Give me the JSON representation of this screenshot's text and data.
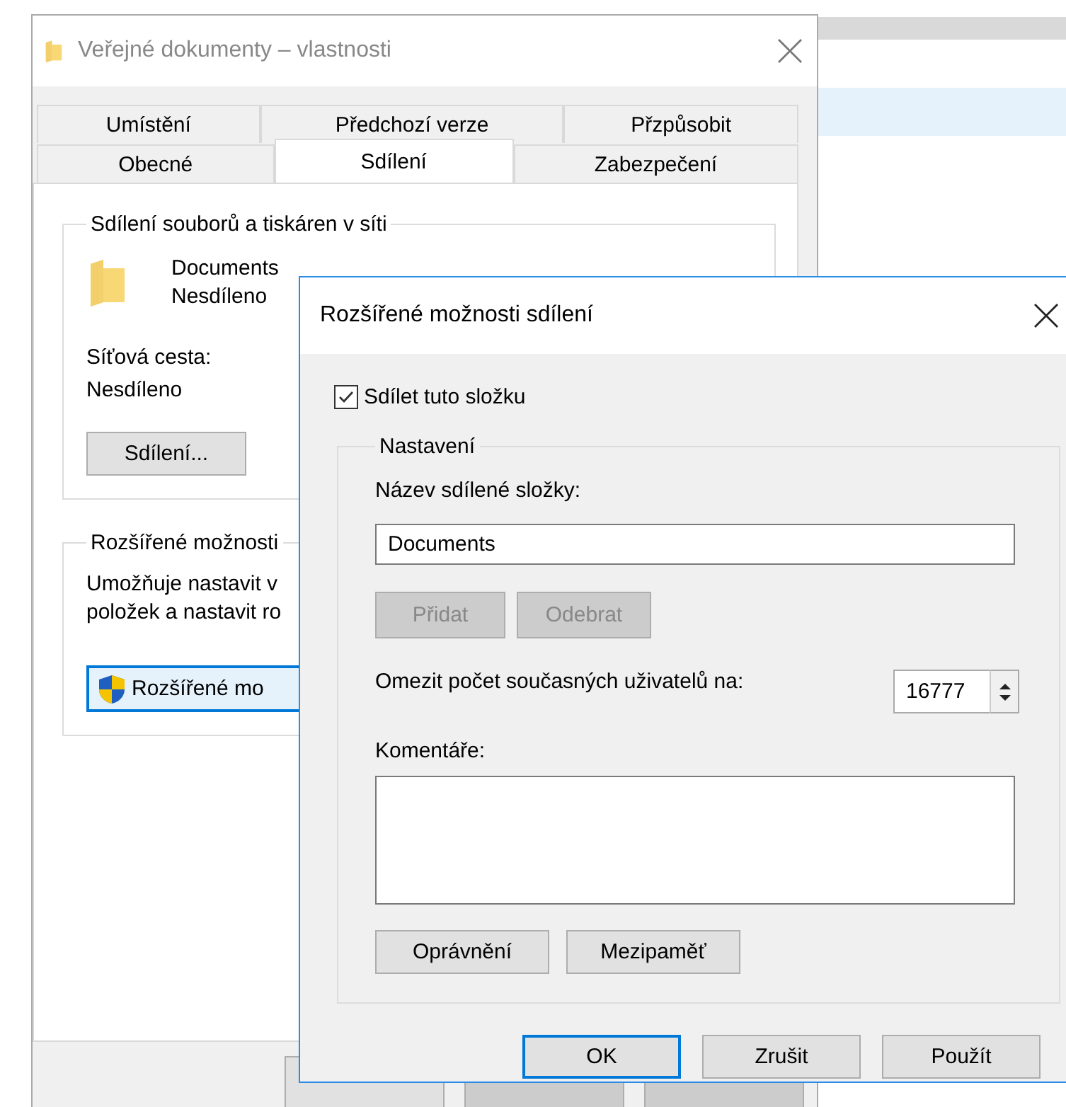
{
  "properties_window": {
    "title": "Veřejné dokumenty – vlastnosti",
    "tab_rows": [
      [
        {
          "label": "Umístění",
          "selected": false
        },
        {
          "label": "Předchozí verze",
          "selected": false
        },
        {
          "label": "Přzpůsobit",
          "selected": false
        }
      ],
      [
        {
          "label": "Obecné",
          "selected": false
        },
        {
          "label": "Sdílení",
          "selected": true
        },
        {
          "label": "Zabezpečení",
          "selected": false
        }
      ]
    ],
    "sharing_group": {
      "title": "Sdílení souborů a tiskáren v síti",
      "name": "Documents",
      "status": "Nesdíleno",
      "path_label": "Síťová cesta:",
      "path_value": "Nesdíleno",
      "button": "Sdílení..."
    },
    "advanced_group": {
      "title": "Rozšířené možnosti",
      "lines": [
        "Umožňuje nastavit v",
        "položek a nastavit ro"
      ],
      "button": "Rozšířené mo"
    },
    "footer_buttons": [
      {
        "disabled": false
      },
      {
        "disabled": true
      },
      {
        "disabled": true
      }
    ]
  },
  "advanced_dialog": {
    "title": "Rozšířené možnosti sdílení",
    "share_checkbox": {
      "label": "Sdílet tuto složku",
      "checked": true
    },
    "settings_group": {
      "title": "Nastavení",
      "share_name_label": "Název sdílené složky:",
      "share_name": "Documents",
      "add_button": {
        "label": "Přidat",
        "disabled": true
      },
      "remove_button": {
        "label": "Odebrat",
        "disabled": true
      },
      "limit_label": "Omezit počet současných uživatelů na:",
      "limit_value": "16777",
      "comments_label": "Komentáře:",
      "permissions_button": "Oprávnění",
      "caching_button": "Mezipaměť"
    },
    "buttons": [
      {
        "label": "OK",
        "default": true
      },
      {
        "label": "Zrušit",
        "default": false
      },
      {
        "label": "Použít",
        "default": false
      }
    ]
  }
}
